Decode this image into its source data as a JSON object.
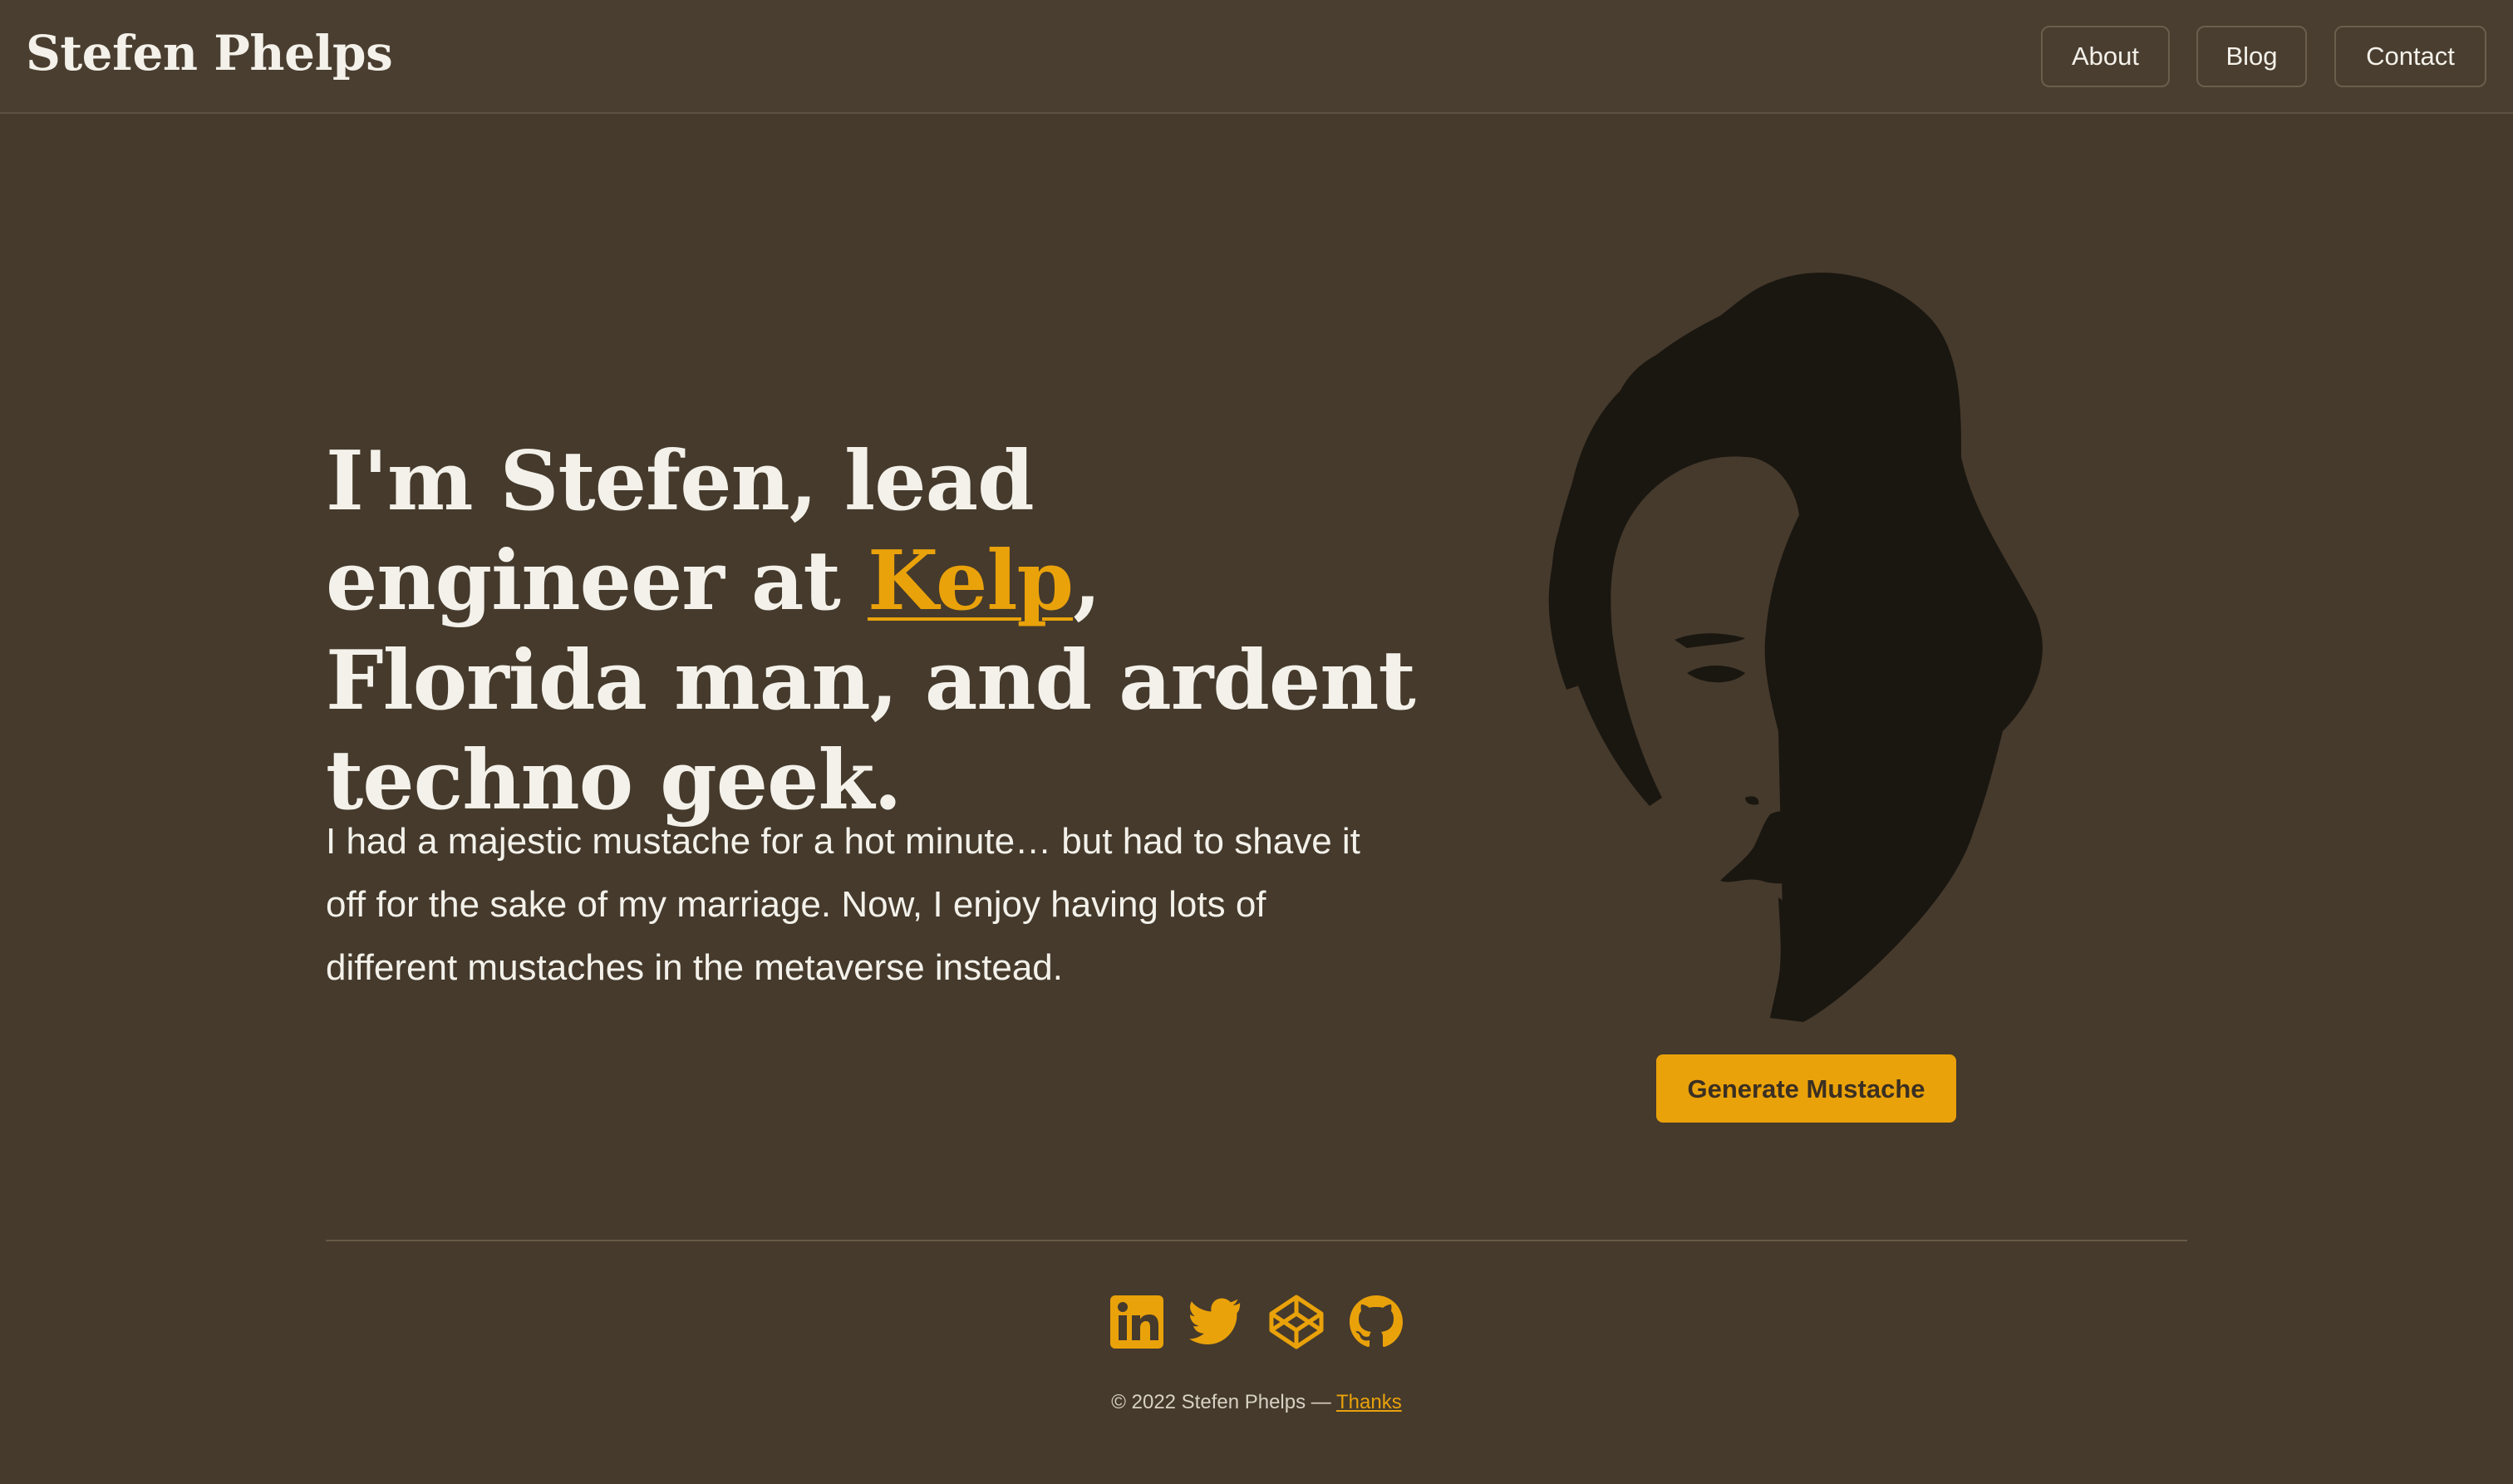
{
  "header": {
    "site_title": "Stefen Phelps",
    "nav": {
      "about": "About",
      "blog": "Blog",
      "contact": "Contact"
    }
  },
  "hero": {
    "headline_prefix": "I'm Stefen, lead engineer at ",
    "headline_link": "Kelp",
    "headline_suffix": ", Florida man, and ardent techno geek.",
    "bio": "I had a majestic mustache for a hot minute… but had to shave it off for the sake of my marriage. Now, I enjoy having lots of different mustaches in the metaverse instead.",
    "generate_button": "Generate Mustache"
  },
  "footer": {
    "social_icons": [
      "linkedin-icon",
      "twitter-icon",
      "codepen-icon",
      "github-icon"
    ],
    "copyright": "© 2022 Stefen Phelps — ",
    "thanks_link": "Thanks"
  },
  "colors": {
    "background": "#453a2c",
    "header_background": "#4a3e30",
    "accent": "#eaa20a",
    "text": "#f3f1ea",
    "portrait_ink": "#1a1610"
  }
}
